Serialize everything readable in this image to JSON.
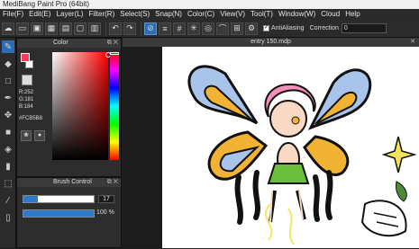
{
  "window": {
    "title": "MediBang Paint Pro (64bit)"
  },
  "menu": [
    "File(F)",
    "Edit(E)",
    "Layer(L)",
    "Filter(R)",
    "Select(S)",
    "Snap(N)",
    "Color(C)",
    "View(V)",
    "Tool(T)",
    "Window(W)",
    "Cloud",
    "Help"
  ],
  "toolbar": {
    "antialiasing_label": "AntiAliasing",
    "correction_label": "Correction",
    "correction_value": "0"
  },
  "color_panel": {
    "title": "Color",
    "r": "R:252",
    "g": "G:181",
    "b": "B:184",
    "hex": "#FCB5B8",
    "fg_color": "#fc3b58"
  },
  "brush_panel": {
    "title": "Brush Control",
    "size_value": "17",
    "size_fraction": 0.2,
    "opacity_value": "100 %",
    "opacity_fraction": 1.0
  },
  "document": {
    "tab_title": "entry 150.mdp"
  }
}
